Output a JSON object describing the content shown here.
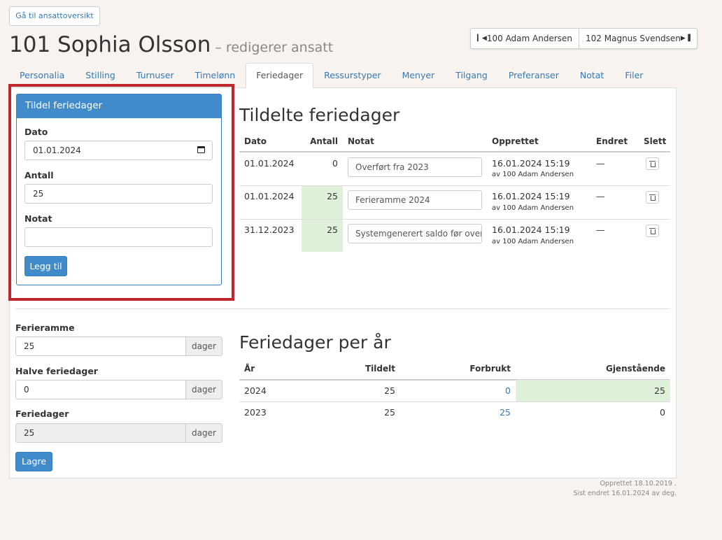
{
  "header": {
    "back_button": "Gå til ansattoversikt",
    "employee_name": "101 Sophia Olsson",
    "subtitle": "– redigerer ansatt",
    "prev_employee": "100 Adam Andersen",
    "next_employee": "102 Magnus Svendsen"
  },
  "tabs": [
    "Personalia",
    "Stilling",
    "Turnuser",
    "Timelønn",
    "Feriedager",
    "Ressurstyper",
    "Menyer",
    "Tilgang",
    "Preferanser",
    "Notat",
    "Filer"
  ],
  "active_tab": "Feriedager",
  "assign_panel": {
    "title": "Tildel feriedager",
    "date_label": "Dato",
    "date_value": "01.01.2024",
    "amount_label": "Antall",
    "amount_value": "25",
    "note_label": "Notat",
    "note_value": "",
    "add_button": "Legg til"
  },
  "settings": {
    "ferieramme_label": "Ferieramme",
    "ferieramme_value": "25",
    "halve_label": "Halve feriedager",
    "halve_value": "0",
    "feriedager_label": "Feriedager",
    "feriedager_value": "25",
    "unit": "dager",
    "save_button": "Lagre"
  },
  "assigned": {
    "title": "Tildelte feriedager",
    "columns": [
      "Dato",
      "Antall",
      "Notat",
      "Opprettet",
      "Endret",
      "Slett"
    ],
    "rows": [
      {
        "date": "01.01.2024",
        "amount": "0",
        "note": "Overført fra 2023",
        "created": "16.01.2024 15:19",
        "by": "av 100 Adam Andersen",
        "changed": "—"
      },
      {
        "date": "01.01.2024",
        "amount": "25",
        "note": "Ferieramme 2024",
        "created": "16.01.2024 15:19",
        "by": "av 100 Adam Andersen",
        "changed": "—"
      },
      {
        "date": "31.12.2023",
        "amount": "25",
        "note": "Systemgenerert saldo før overføring",
        "created": "16.01.2024 15:19",
        "by": "av 100 Adam Andersen",
        "changed": "—"
      }
    ]
  },
  "per_year": {
    "title": "Feriedager per år",
    "columns": [
      "År",
      "Tildelt",
      "Forbrukt",
      "Gjenstående"
    ],
    "rows": [
      {
        "year": "2024",
        "assigned": "25",
        "used": "0",
        "remaining": "25"
      },
      {
        "year": "2023",
        "assigned": "25",
        "used": "25",
        "remaining": "0"
      }
    ]
  },
  "footer": {
    "created": "Opprettet 18.10.2019 .",
    "modified": "Sist endret 16.01.2024 av deg."
  },
  "colors": {
    "primary": "#428bca",
    "highlight_border": "#c0272d",
    "success_bg": "#dff0d8",
    "link": "#337ab7"
  }
}
